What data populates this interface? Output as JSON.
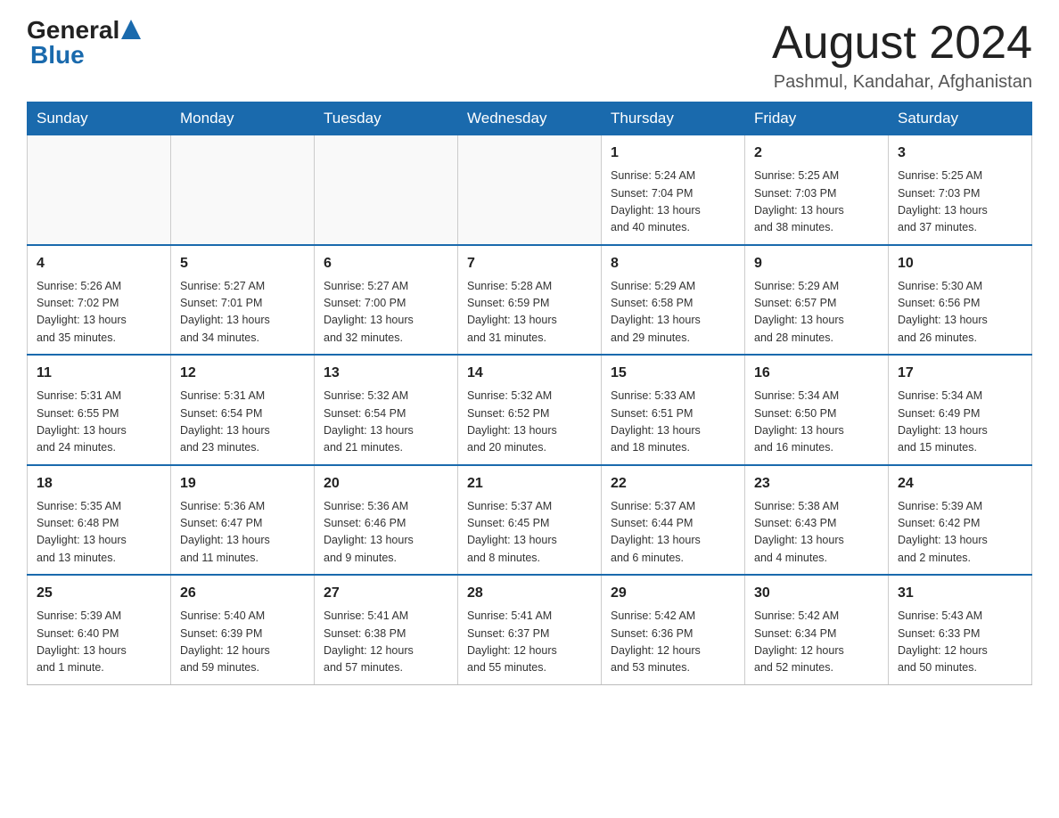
{
  "logo": {
    "general": "General",
    "arrow": "▲",
    "blue": "Blue"
  },
  "title": "August 2024",
  "subtitle": "Pashmul, Kandahar, Afghanistan",
  "days_of_week": [
    "Sunday",
    "Monday",
    "Tuesday",
    "Wednesday",
    "Thursday",
    "Friday",
    "Saturday"
  ],
  "weeks": [
    [
      {
        "day": "",
        "info": ""
      },
      {
        "day": "",
        "info": ""
      },
      {
        "day": "",
        "info": ""
      },
      {
        "day": "",
        "info": ""
      },
      {
        "day": "1",
        "info": "Sunrise: 5:24 AM\nSunset: 7:04 PM\nDaylight: 13 hours\nand 40 minutes."
      },
      {
        "day": "2",
        "info": "Sunrise: 5:25 AM\nSunset: 7:03 PM\nDaylight: 13 hours\nand 38 minutes."
      },
      {
        "day": "3",
        "info": "Sunrise: 5:25 AM\nSunset: 7:03 PM\nDaylight: 13 hours\nand 37 minutes."
      }
    ],
    [
      {
        "day": "4",
        "info": "Sunrise: 5:26 AM\nSunset: 7:02 PM\nDaylight: 13 hours\nand 35 minutes."
      },
      {
        "day": "5",
        "info": "Sunrise: 5:27 AM\nSunset: 7:01 PM\nDaylight: 13 hours\nand 34 minutes."
      },
      {
        "day": "6",
        "info": "Sunrise: 5:27 AM\nSunset: 7:00 PM\nDaylight: 13 hours\nand 32 minutes."
      },
      {
        "day": "7",
        "info": "Sunrise: 5:28 AM\nSunset: 6:59 PM\nDaylight: 13 hours\nand 31 minutes."
      },
      {
        "day": "8",
        "info": "Sunrise: 5:29 AM\nSunset: 6:58 PM\nDaylight: 13 hours\nand 29 minutes."
      },
      {
        "day": "9",
        "info": "Sunrise: 5:29 AM\nSunset: 6:57 PM\nDaylight: 13 hours\nand 28 minutes."
      },
      {
        "day": "10",
        "info": "Sunrise: 5:30 AM\nSunset: 6:56 PM\nDaylight: 13 hours\nand 26 minutes."
      }
    ],
    [
      {
        "day": "11",
        "info": "Sunrise: 5:31 AM\nSunset: 6:55 PM\nDaylight: 13 hours\nand 24 minutes."
      },
      {
        "day": "12",
        "info": "Sunrise: 5:31 AM\nSunset: 6:54 PM\nDaylight: 13 hours\nand 23 minutes."
      },
      {
        "day": "13",
        "info": "Sunrise: 5:32 AM\nSunset: 6:54 PM\nDaylight: 13 hours\nand 21 minutes."
      },
      {
        "day": "14",
        "info": "Sunrise: 5:32 AM\nSunset: 6:52 PM\nDaylight: 13 hours\nand 20 minutes."
      },
      {
        "day": "15",
        "info": "Sunrise: 5:33 AM\nSunset: 6:51 PM\nDaylight: 13 hours\nand 18 minutes."
      },
      {
        "day": "16",
        "info": "Sunrise: 5:34 AM\nSunset: 6:50 PM\nDaylight: 13 hours\nand 16 minutes."
      },
      {
        "day": "17",
        "info": "Sunrise: 5:34 AM\nSunset: 6:49 PM\nDaylight: 13 hours\nand 15 minutes."
      }
    ],
    [
      {
        "day": "18",
        "info": "Sunrise: 5:35 AM\nSunset: 6:48 PM\nDaylight: 13 hours\nand 13 minutes."
      },
      {
        "day": "19",
        "info": "Sunrise: 5:36 AM\nSunset: 6:47 PM\nDaylight: 13 hours\nand 11 minutes."
      },
      {
        "day": "20",
        "info": "Sunrise: 5:36 AM\nSunset: 6:46 PM\nDaylight: 13 hours\nand 9 minutes."
      },
      {
        "day": "21",
        "info": "Sunrise: 5:37 AM\nSunset: 6:45 PM\nDaylight: 13 hours\nand 8 minutes."
      },
      {
        "day": "22",
        "info": "Sunrise: 5:37 AM\nSunset: 6:44 PM\nDaylight: 13 hours\nand 6 minutes."
      },
      {
        "day": "23",
        "info": "Sunrise: 5:38 AM\nSunset: 6:43 PM\nDaylight: 13 hours\nand 4 minutes."
      },
      {
        "day": "24",
        "info": "Sunrise: 5:39 AM\nSunset: 6:42 PM\nDaylight: 13 hours\nand 2 minutes."
      }
    ],
    [
      {
        "day": "25",
        "info": "Sunrise: 5:39 AM\nSunset: 6:40 PM\nDaylight: 13 hours\nand 1 minute."
      },
      {
        "day": "26",
        "info": "Sunrise: 5:40 AM\nSunset: 6:39 PM\nDaylight: 12 hours\nand 59 minutes."
      },
      {
        "day": "27",
        "info": "Sunrise: 5:41 AM\nSunset: 6:38 PM\nDaylight: 12 hours\nand 57 minutes."
      },
      {
        "day": "28",
        "info": "Sunrise: 5:41 AM\nSunset: 6:37 PM\nDaylight: 12 hours\nand 55 minutes."
      },
      {
        "day": "29",
        "info": "Sunrise: 5:42 AM\nSunset: 6:36 PM\nDaylight: 12 hours\nand 53 minutes."
      },
      {
        "day": "30",
        "info": "Sunrise: 5:42 AM\nSunset: 6:34 PM\nDaylight: 12 hours\nand 52 minutes."
      },
      {
        "day": "31",
        "info": "Sunrise: 5:43 AM\nSunset: 6:33 PM\nDaylight: 12 hours\nand 50 minutes."
      }
    ]
  ]
}
